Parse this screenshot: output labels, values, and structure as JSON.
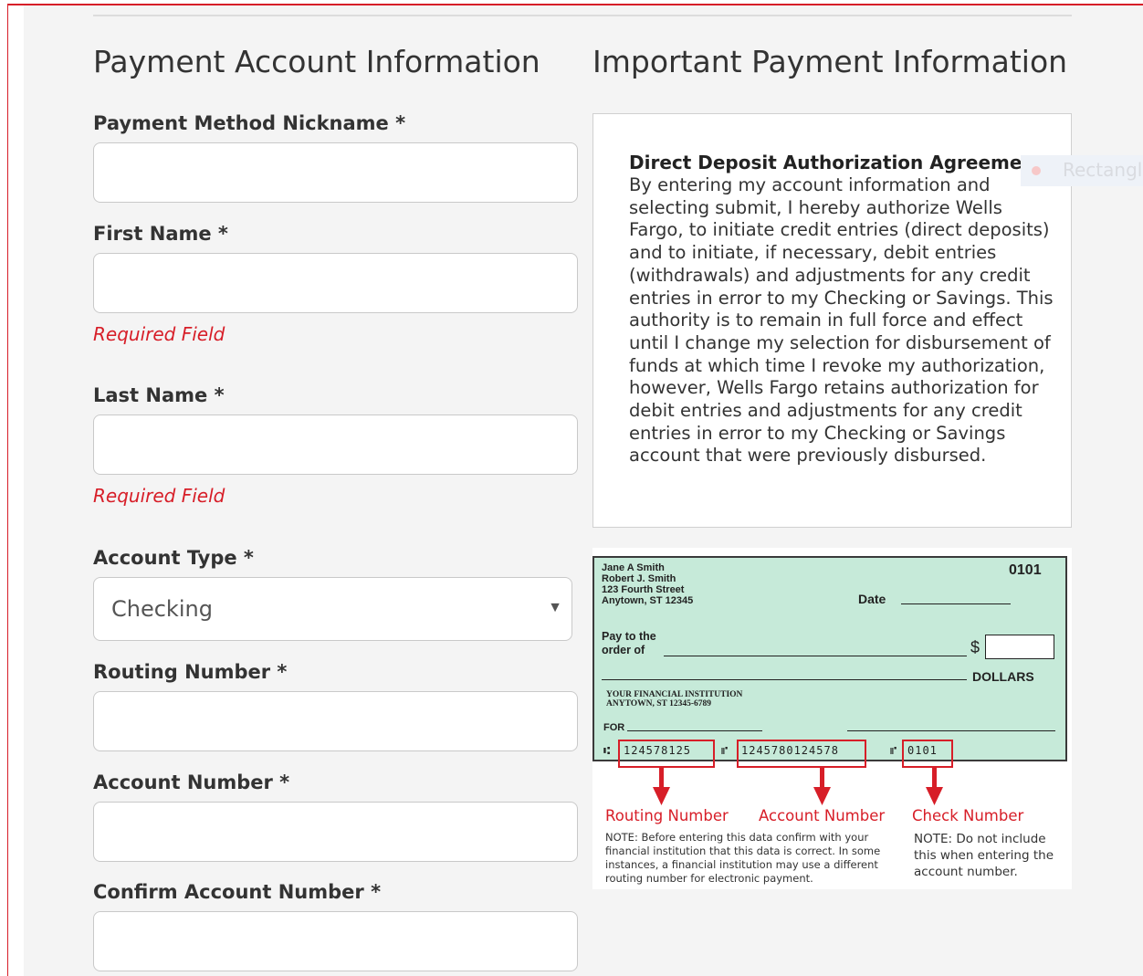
{
  "left": {
    "title": "Payment Account Information",
    "fields": [
      {
        "label": "Payment Method Nickname *",
        "value": ""
      },
      {
        "label": "First Name *",
        "value": "",
        "error": "Required Field"
      },
      {
        "label": "Last Name *",
        "value": "",
        "error": "Required Field"
      },
      {
        "label": "Routing Number *",
        "value": ""
      },
      {
        "label": "Account Number *",
        "value": ""
      },
      {
        "label": "Confirm Account Number *",
        "value": ""
      }
    ],
    "account_type": {
      "label": "Account Type *",
      "selected": "Checking",
      "arrow": "▼"
    }
  },
  "right": {
    "title": "Important Payment Information",
    "agreement": {
      "title": "Direct Deposit Authorization Agreement",
      "body": "By entering my account information and selecting submit, I hereby authorize Wells Fargo, to initiate credit entries (direct deposits) and to initiate, if necessary, debit entries (withdrawals) and adjustments for any credit entries in error to my Checking or Savings. This authority is to remain in full force and effect until I change my selection for disbursement of funds at which time I revoke my authorization, however, Wells Fargo retains authorization for debit entries and adjustments for any credit entries in error to my Checking or Savings account that were previously disbursed."
    },
    "ghost_tooltip": "Rectangl",
    "check": {
      "names": [
        "Jane A Smith",
        "Robert J. Smith",
        "123 Fourth Street",
        "Anytown, ST 12345"
      ],
      "number": "0101",
      "date_label": "Date",
      "pay_to": [
        "Pay to the",
        "order of"
      ],
      "dollar_sign": "$",
      "dollars": "DOLLARS",
      "institution": [
        "YOUR FINANCIAL INSTITUTION",
        "ANYTOWN, ST 12345-6789"
      ],
      "for_label": "FOR",
      "micr_routing": "124578125",
      "micr_account": "1245780124578",
      "micr_check": "0101",
      "micr_sym_left": "⑆",
      "micr_sym_mid": "⑈",
      "micr_sym_right": "⑈"
    },
    "labels": {
      "routing": "Routing Number",
      "account": "Account Number",
      "check_number": "Check Number"
    },
    "notes": {
      "left": "NOTE: Before entering this data confirm with your financial institution that this data is correct.  In some instances, a financial institution may use a different routing number for electronic payment.",
      "right": "NOTE: Do not include this when entering the account number."
    },
    "colors": {
      "accent": "#d71e28",
      "check_bg": "#c6ead9"
    }
  }
}
